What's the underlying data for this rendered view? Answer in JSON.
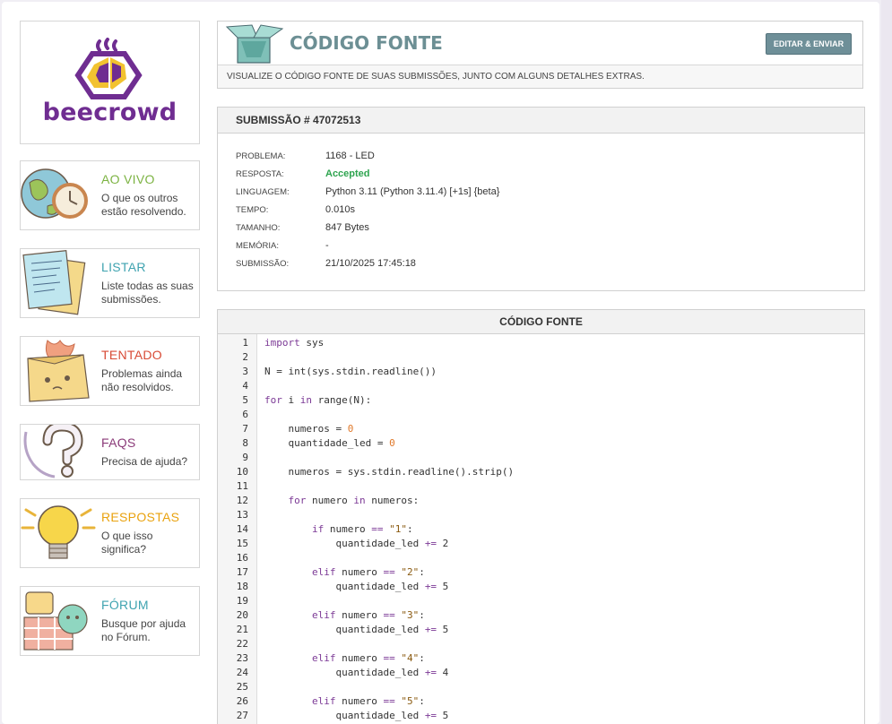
{
  "brand": {
    "name": "beecrowd"
  },
  "nav": [
    {
      "title": "AO VIVO",
      "desc": "O que os outros estão resolvendo.",
      "color": "#7cb342",
      "icon": "globe-clock-icon"
    },
    {
      "title": "LISTAR",
      "desc": "Liste todas as suas submissões.",
      "color": "#3fa3b0",
      "icon": "papers-list-icon"
    },
    {
      "title": "TENTADO",
      "desc": "Problemas ainda não resolvidos.",
      "color": "#d84a35",
      "icon": "burning-box-icon"
    },
    {
      "title": "FAQS",
      "desc": "Precisa de ajuda?",
      "color": "#8b3b79",
      "icon": "question-mark-icon"
    },
    {
      "title": "RESPOSTAS",
      "desc": "O que isso significa?",
      "color": "#e9a20e",
      "icon": "lightbulb-icon"
    },
    {
      "title": "FÓRUM",
      "desc": "Busque por ajuda no Fórum.",
      "color": "#3fa3b0",
      "icon": "chat-bubbles-icon"
    }
  ],
  "header": {
    "title": "CÓDIGO FONTE",
    "subtitle": "VISUALIZE O CÓDIGO FONTE DE SUAS SUBMISSÕES, JUNTO COM ALGUNS DETALHES EXTRAS.",
    "edit_button": "EDITAR & ENVIAR",
    "icon": "open-box-icon"
  },
  "submission": {
    "heading": "SUBMISSÃO # 47072513",
    "rows": [
      {
        "label": "PROBLEMA:",
        "value": "1168 - LED"
      },
      {
        "label": "RESPOSTA:",
        "value": "Accepted"
      },
      {
        "label": "LINGUAGEM:",
        "value": "Python 3.11 (Python 3.11.4) [+1s] {beta}"
      },
      {
        "label": "TEMPO:",
        "value": "0.010s"
      },
      {
        "label": "TAMANHO:",
        "value": "847 Bytes"
      },
      {
        "label": "MEMÓRIA:",
        "value": "-"
      },
      {
        "label": "SUBMISSÃO:",
        "value": "21/10/2025 17:45:18"
      }
    ],
    "accepted_color": "#2ea44f"
  },
  "code": {
    "heading": "CÓDIGO FONTE",
    "lines": [
      "import sys",
      "",
      "N = int(sys.stdin.readline())",
      "",
      "for i in range(N):",
      "",
      "    numeros = 0",
      "    quantidade_led = 0",
      "",
      "    numeros = sys.stdin.readline().strip()",
      "",
      "    for numero in numeros:",
      "",
      "        if numero == \"1\":",
      "            quantidade_led += 2",
      "",
      "        elif numero == \"2\":",
      "            quantidade_led += 5",
      "",
      "        elif numero == \"3\":",
      "            quantidade_led += 5",
      "",
      "        elif numero == \"4\":",
      "            quantidade_led += 4",
      "",
      "        elif numero == \"5\":",
      "            quantidade_led += 5"
    ]
  }
}
